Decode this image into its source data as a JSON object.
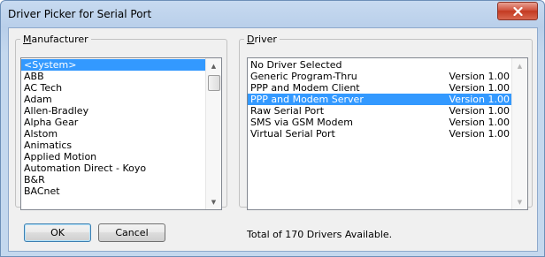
{
  "window": {
    "title": "Driver Picker for Serial Port"
  },
  "manufacturer": {
    "label": "Manufacturer",
    "items": [
      {
        "label": "<System>",
        "selected": true
      },
      {
        "label": "ABB"
      },
      {
        "label": "AC Tech"
      },
      {
        "label": "Adam"
      },
      {
        "label": "Allen-Bradley"
      },
      {
        "label": "Alpha Gear"
      },
      {
        "label": "Alstom"
      },
      {
        "label": "Animatics"
      },
      {
        "label": "Applied Motion"
      },
      {
        "label": "Automation Direct - Koyo"
      },
      {
        "label": "B&R"
      },
      {
        "label": "BACnet"
      }
    ]
  },
  "driver": {
    "label": "Driver",
    "items": [
      {
        "name": "No Driver Selected",
        "version": ""
      },
      {
        "name": "Generic Program-Thru",
        "version": "Version 1.00"
      },
      {
        "name": "PPP and Modem Client",
        "version": "Version 1.00"
      },
      {
        "name": "PPP and Modem Server",
        "version": "Version 1.00",
        "selected": true
      },
      {
        "name": "Raw Serial Port",
        "version": "Version 1.00"
      },
      {
        "name": "SMS via GSM Modem",
        "version": "Version 1.00"
      },
      {
        "name": "Virtual Serial Port",
        "version": "Version 1.00"
      }
    ]
  },
  "buttons": {
    "ok": "OK",
    "cancel": "Cancel"
  },
  "status_text": "Total of 170 Drivers Available.",
  "colors": {
    "selection": "#3399ff",
    "close_button": "#c43a21"
  },
  "icons": {
    "close": "close-icon",
    "scroll_up": "scroll-up-arrow-icon",
    "scroll_down": "scroll-down-arrow-icon"
  }
}
